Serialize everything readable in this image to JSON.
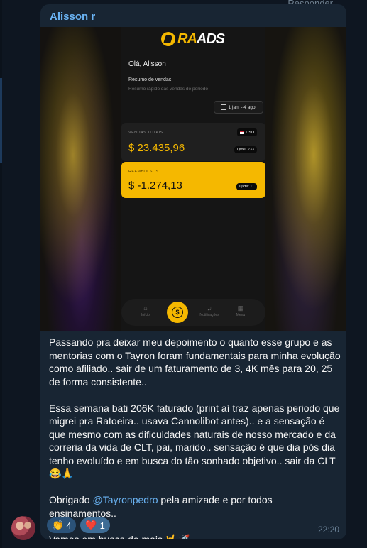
{
  "header": {
    "reply_label": "Responder"
  },
  "message": {
    "sender": "Alisson r",
    "screenshot": {
      "brand_ra": "RA",
      "brand_ads": "ADS",
      "greeting": "Olá, Alisson",
      "summary_title": "Resumo de vendas",
      "summary_subtitle": "Resumo rápido das vendas do período",
      "date_range": "1 jan. - 4 ago.",
      "total_label": "VENDAS TOTAIS",
      "currency": "USD",
      "total_amount": "$ 23.435,96",
      "total_qty": "Qtde: 233",
      "refund_label": "REEMBOLSOS",
      "refund_amount": "$ -1.274,13",
      "refund_qty": "Qtde: 11",
      "nav": {
        "home": "Início",
        "notifications": "Notificações",
        "menu": "Menu"
      },
      "colors": {
        "accent": "#f5b800",
        "background": "#151515"
      }
    },
    "paragraph1": "Passando pra deixar meu depoimento o quanto esse grupo e as mentorias com o Tayron foram fundamentais para minha evolução como afiliado.. sair de um faturamento de 3, 4K mês para 20, 25 de forma consistente..",
    "paragraph2": "Essa semana bati 206K faturado (print aí traz apenas periodo que migrei pra Ratoeira.. usava Cannolibot antes).. e a sensação é que mesmo com as dificuldades naturais de nosso mercado e da correria da vida de CLT, pai, marido.. sensação é que dia pós dia tenho evoluído e em busca do tão sonhado objetivo.. sair da CLT 😂🙏",
    "paragraph3_before": "Obrigado ",
    "mention": "@Tayronpedro",
    "paragraph3_after": " pela amizade e por todos ensinamentos..",
    "paragraph4": "Vamos em busca de mais 🤟🚀",
    "reactions": [
      {
        "emoji": "👏",
        "count": "4"
      },
      {
        "emoji": "❤️",
        "count": "1"
      }
    ],
    "time": "22:20"
  },
  "colors": {
    "chat_bg": "#0e1621",
    "bubble_bg": "#182533",
    "link": "#6ab3f3"
  }
}
